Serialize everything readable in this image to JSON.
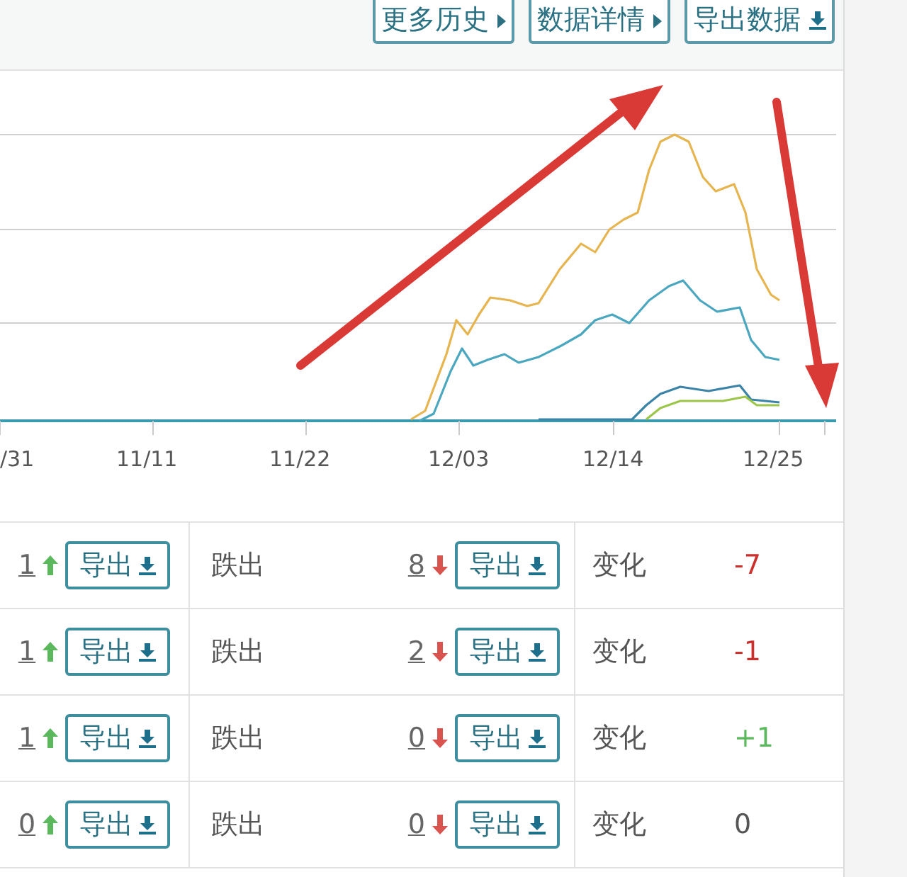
{
  "toolbar": {
    "buttons": [
      {
        "label": "更多历史",
        "kind": "link"
      },
      {
        "label": "数据详情",
        "kind": "link"
      },
      {
        "label": "导出数据",
        "kind": "export"
      }
    ]
  },
  "chart": {
    "x_labels": [
      "/31",
      "11/11",
      "11/22",
      "12/03",
      "12/14",
      "12/25"
    ]
  },
  "rows": [
    {
      "in_count": "1",
      "in_export": "导出",
      "out_label": "跌出",
      "out_count": "8",
      "out_export": "导出",
      "change_label": "变化",
      "change": "-7",
      "color": "#c9302c"
    },
    {
      "in_count": "1",
      "in_export": "导出",
      "out_label": "跌出",
      "out_count": "2",
      "out_export": "导出",
      "change_label": "变化",
      "change": "-1",
      "color": "#c9302c"
    },
    {
      "in_count": "1",
      "in_export": "导出",
      "out_label": "跌出",
      "out_count": "0",
      "out_export": "导出",
      "change_label": "变化",
      "change": "+1",
      "color": "#5cb85c"
    },
    {
      "in_count": "0",
      "in_export": "导出",
      "out_label": "跌出",
      "out_count": "0",
      "out_export": "导出",
      "change_label": "变化",
      "change": "0",
      "color": "#555555"
    }
  ]
}
